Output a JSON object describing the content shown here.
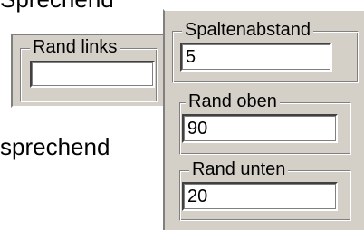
{
  "background_text": {
    "top_clipped": "Sprechend",
    "side": "sprechend"
  },
  "groups": {
    "rand_links": {
      "label": "Rand links",
      "value": ""
    },
    "spaltenabstand": {
      "label": "Spaltenabstand",
      "value": "5"
    },
    "rand_oben": {
      "label": "Rand oben",
      "value": "90"
    },
    "rand_unten": {
      "label": "Rand unten",
      "value": "20"
    }
  },
  "colors": {
    "dialog_face": "#d4d0c8",
    "shadow": "#808080",
    "highlight": "#ffffff",
    "field_bg": "#ffffff"
  }
}
